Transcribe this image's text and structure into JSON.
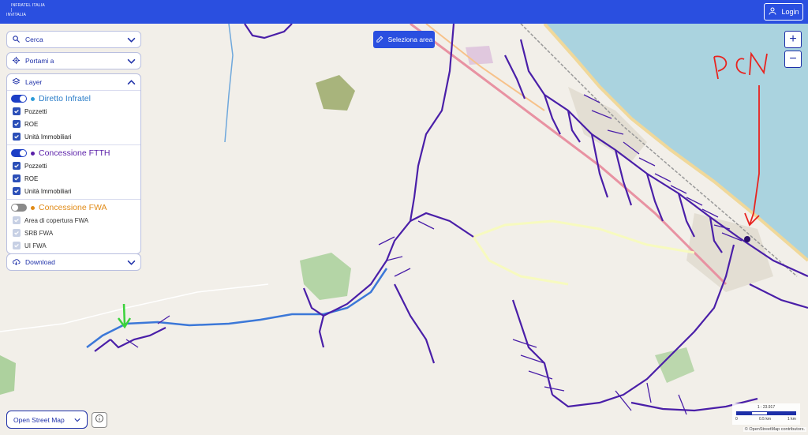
{
  "header": {
    "logo_line1": "INFRATEL ITALIA",
    "logo_line2": "|",
    "logo_line3": "INVITALIA",
    "login_label": "Login"
  },
  "panel": {
    "search_label": "Cerca",
    "goto_label": "Portami a",
    "layer_label": "Layer",
    "download_label": "Download",
    "sections": [
      {
        "title": "Diretto Infratel",
        "enabled": true,
        "color": "#2b9bd8",
        "items": [
          {
            "label": "Pozzetti",
            "checked": true
          },
          {
            "label": "ROE",
            "checked": true
          },
          {
            "label": "Unità Immobiliari",
            "checked": true
          }
        ]
      },
      {
        "title": "Concessione FTTH",
        "enabled": true,
        "color": "#5a1fa8",
        "items": [
          {
            "label": "Pozzetti",
            "checked": true
          },
          {
            "label": "ROE",
            "checked": true
          },
          {
            "label": "Unità Immobiliari",
            "checked": true
          }
        ]
      },
      {
        "title": "Concessione FWA",
        "enabled": false,
        "color": "#e08a16",
        "items": [
          {
            "label": "Area di copertura FWA",
            "checked": false
          },
          {
            "label": "SRB FWA",
            "checked": false
          },
          {
            "label": "UI FWA",
            "checked": false
          }
        ]
      }
    ]
  },
  "map": {
    "select_area_label": "Seleziona area",
    "zoom_in": "+",
    "zoom_out": "−",
    "basemap_label": "Open Street Map",
    "annotation_text": "PCN",
    "scale_ratio": "1 : 23.917",
    "scale_labels": [
      "0",
      "0.5 km",
      "1 km"
    ],
    "attribution": "© OpenStreetMap contributors.",
    "colors": {
      "sea": "#aad3df",
      "land": "#f2efe9",
      "network_ftth": "#4a1fa8",
      "network_infratel": "#3c78d8",
      "annotation_red": "#e8231f",
      "annotation_green": "#3bd23b",
      "primary": "#2a4fe0"
    }
  }
}
